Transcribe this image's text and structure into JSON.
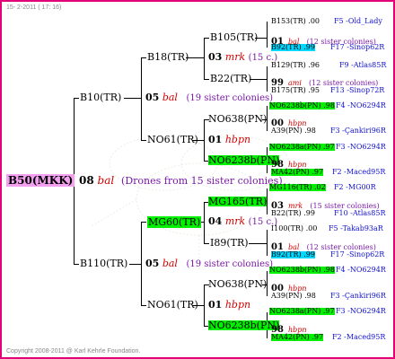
{
  "header": {
    "date": "15-  2-2011 ( 17: 16)"
  },
  "footer": {
    "copyright": "Copyright 2008-2011 @ Karl Kehrle Foundation."
  },
  "root": {
    "name": "B50(MKK)",
    "year": "08",
    "breeder": "bal",
    "note": "(Drones from 15 sister colonies)"
  },
  "mother": {
    "name": "B10(TR)",
    "year": "05",
    "breeder": "bal",
    "note": "(19 sister colonies)"
  },
  "father": {
    "name": "B110(TR)",
    "year": "05",
    "breeder": "bal",
    "note": "(19 sister colonies)"
  },
  "mm": {
    "name": "B18(TR)",
    "year": "03",
    "breeder": "mrk",
    "note": "(15 c.)"
  },
  "mf": {
    "name": "NO61(TR)",
    "year": "01",
    "breeder": "hbpn"
  },
  "fm": {
    "name": "MG60(TR)",
    "year": "04",
    "breeder": "mrk",
    "note": "(15 c.)"
  },
  "ff": {
    "name": "NO61(TR)",
    "year": "01",
    "breeder": "hbpn"
  },
  "g4": [
    {
      "name": "B105(TR)"
    },
    {
      "name": "B22(TR)"
    },
    {
      "name": "NO638(PN)"
    },
    {
      "name": "NO6238b(PN)"
    },
    {
      "name": "MG165(TR)"
    },
    {
      "name": "I89(TR)"
    },
    {
      "name": "NO638(PN)"
    },
    {
      "name": "NO6238b(PN)"
    }
  ],
  "g4_mid": [
    {
      "year": "01",
      "breeder": "bal",
      "note": "(12 sister colonies)"
    },
    {
      "year": "99",
      "breeder": "ami",
      "note": "(12 sister colonies)"
    },
    {
      "year": "00",
      "breeder": "hbpn"
    },
    {
      "year": "98",
      "breeder": "hbpn"
    },
    {
      "year": "03",
      "breeder": "mrk",
      "note": "(15 sister colonies)"
    },
    {
      "year": "01",
      "breeder": "bal",
      "note": "(12 sister colonies)"
    },
    {
      "year": "00",
      "breeder": "hbpn"
    },
    {
      "year": "98",
      "breeder": "hbpn"
    }
  ],
  "g5": [
    {
      "name": "B153(TR) .00",
      "right": "F5 -Old_Lady"
    },
    {
      "name": "B92(TR) .99",
      "right": "F17 -Sinop62R"
    },
    {
      "name": "B129(TR) .96",
      "right": "F9 -Atlas85R"
    },
    {
      "name": "B175(TR) .95",
      "right": "F13 -Sinop72R"
    },
    {
      "name": "NO6238b(PN) .98",
      "right": "F4 -NO6294R"
    },
    {
      "name": "A39(PN) .98",
      "right": "F3 -Çankiri96R"
    },
    {
      "name": "NO6238a(PN) .97",
      "right": "F3 -NO6294R"
    },
    {
      "name": "MA42(PN) .97",
      "right": "F2 -Maced95R"
    },
    {
      "name": "MG116(TR) .02",
      "right": "F2 -MG00R"
    },
    {
      "name": "B22(TR) .99",
      "right": "F10 -Atlas85R"
    },
    {
      "name": "I100(TR) .00",
      "right": "F5 -Takab93aR"
    },
    {
      "name": "B92(TR) .99",
      "right": "F17 -Sinop62R"
    },
    {
      "name": "NO6238b(PN) .98",
      "right": "F4 -NO6294R"
    },
    {
      "name": "A39(PN) .98",
      "right": "F3 -Çankiri96R"
    },
    {
      "name": "NO6238a(PN) .97",
      "right": "F3 -NO6294R"
    },
    {
      "name": "MA42(PN) .97",
      "right": "F2 -Maced95R"
    }
  ]
}
